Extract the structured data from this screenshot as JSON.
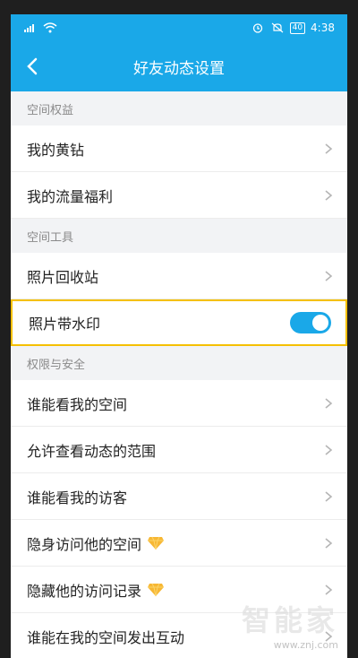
{
  "statusbar": {
    "time": "4:38",
    "battery": "40"
  },
  "header": {
    "title": "好友动态设置"
  },
  "sections": [
    {
      "label": "空间权益",
      "items": [
        {
          "label": "我的黄钻"
        },
        {
          "label": "我的流量福利"
        }
      ]
    },
    {
      "label": "空间工具",
      "items": [
        {
          "label": "照片回收站"
        },
        {
          "label": "照片带水印",
          "toggle": true
        }
      ]
    },
    {
      "label": "权限与安全",
      "items": [
        {
          "label": "谁能看我的空间"
        },
        {
          "label": "允许查看动态的范围"
        },
        {
          "label": "谁能看我的访客"
        },
        {
          "label": "隐身访问他的空间",
          "badge": "diamond-icon"
        },
        {
          "label": "隐藏他的访问记录",
          "badge": "diamond-icon"
        },
        {
          "label": "谁能在我的空间发出互动"
        }
      ]
    }
  ],
  "watermark": {
    "text": "智能家",
    "url": "www.znj.com"
  },
  "colors": {
    "accent": "#1aa8e8",
    "highlight": "#f5c000",
    "badge": "#f7b733"
  }
}
